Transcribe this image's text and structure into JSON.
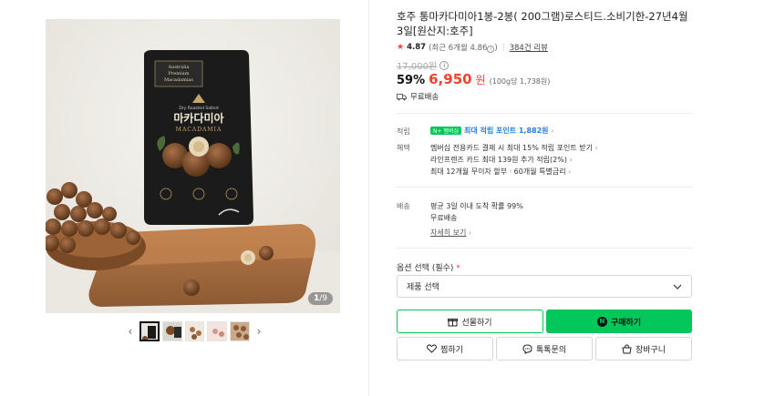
{
  "product": {
    "title": "호주 통마카다미아1봉-2봉( 200그램)로스티드.소비기한-27년4월3일[원산지:호주]",
    "rating": "4.87",
    "rating_recent": "(최근 6개월 4.86",
    "review_count": "384건 리뷰",
    "original_price": "17,000원",
    "discount": "59%",
    "price": "6,950",
    "price_unit": "원",
    "unit_price": "(100g당 1,738원)",
    "shipping": "무료배송"
  },
  "gallery": {
    "counter_current": "1",
    "counter_total": "/9",
    "package": {
      "origin_line1": "Australia",
      "origin_line2": "Premium",
      "origin_line3": "Macadamias",
      "roasted": "Dry Roasted Salted",
      "name_ko": "마카다미아",
      "name_en": "MACADAMIA"
    }
  },
  "benefits": {
    "points_label": "적립",
    "points_badge": "N+ 멤버십",
    "points_text": "최대 적립 포인트 1,882원",
    "benefit_label": "혜택",
    "benefit_lines": [
      "멤버십 전용카드 결제 시 최대 15% 적립 포인트 받기",
      "라인프렌즈 카드 최대 139원 추가 적립(2%)",
      "최대 12개월 무이자 할부 · 60개월 특별금리"
    ],
    "delivery_label": "배송",
    "delivery_lines": [
      "평균 3일 이내 도착 확률 99%",
      "무료배송"
    ],
    "delivery_more": "자세히 보기"
  },
  "options": {
    "label": "옵션 선택 (필수)",
    "required_mark": "*",
    "select_placeholder": "제품 선택"
  },
  "buttons": {
    "gift": "선물하기",
    "buy": "구매하기",
    "wish": "찜하기",
    "talk": "톡톡문의",
    "cart": "장바구니"
  },
  "colors": {
    "accent_green": "#03c75a",
    "price_red": "#f5412f",
    "point_blue": "#2a7de1"
  }
}
